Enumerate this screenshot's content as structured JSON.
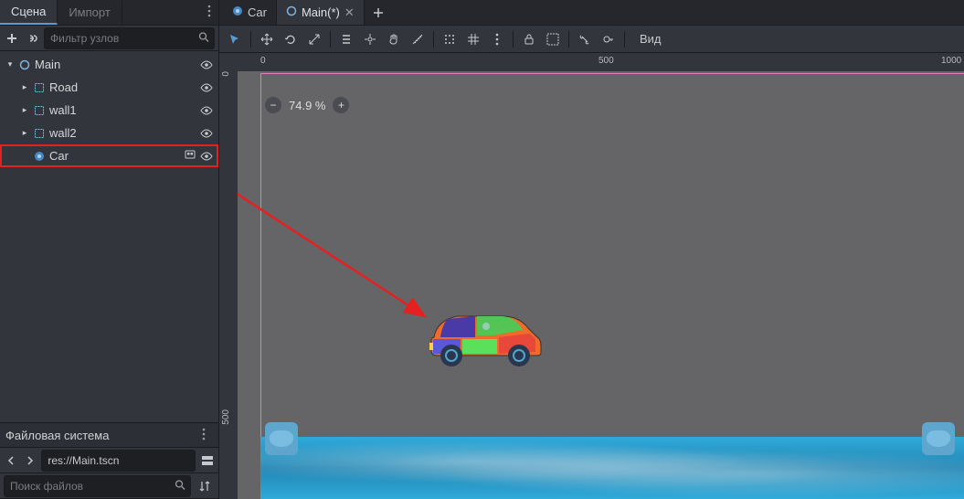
{
  "left": {
    "tabs": [
      "Сцена",
      "Импорт"
    ],
    "active_tab": 0,
    "filter_placeholder": "Фильтр узлов",
    "tree": [
      {
        "name": "Main",
        "type": "node",
        "depth": 0,
        "expandable": true,
        "visible_toggle": true
      },
      {
        "name": "Road",
        "type": "collision",
        "depth": 1,
        "expandable": true,
        "visible_toggle": true
      },
      {
        "name": "wall1",
        "type": "collision",
        "depth": 1,
        "expandable": true,
        "visible_toggle": true
      },
      {
        "name": "wall2",
        "type": "collision",
        "depth": 1,
        "expandable": true,
        "visible_toggle": true
      },
      {
        "name": "Car",
        "type": "scene",
        "depth": 1,
        "expandable": false,
        "visible_toggle": true,
        "highlighted": true,
        "has_scene_icon": true
      }
    ],
    "fs_title": "Файловая система",
    "path": "res://Main.tscn",
    "file_search_placeholder": "Поиск файлов"
  },
  "scene_tabs": [
    {
      "label": "Car",
      "icon": "scene",
      "closable": false,
      "active": false
    },
    {
      "label": "Main(*)",
      "icon": "node",
      "closable": true,
      "active": true
    }
  ],
  "viewport": {
    "zoom_text": "74.9 %",
    "ruler_h": [
      "0",
      "500",
      "1000"
    ],
    "ruler_v": [
      "0",
      "500"
    ],
    "view_button": "Вид"
  },
  "colors": {
    "accent": "#5a9bd4",
    "highlight": "#e52020"
  }
}
